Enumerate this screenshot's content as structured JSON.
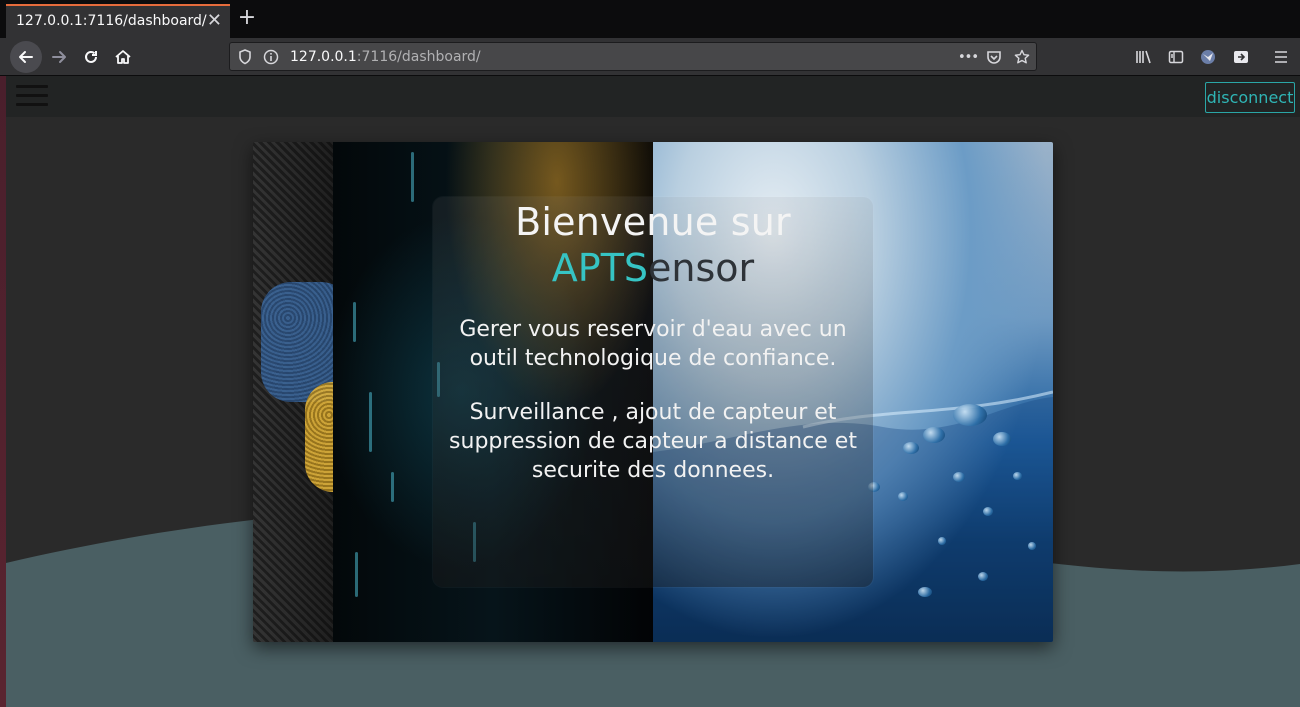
{
  "browser": {
    "tab_title": "127.0.0.1:7116/dashboard/",
    "tab_close": "✕",
    "new_tab": "+",
    "url_host": "127.0.0.1",
    "url_rest": ":7116/dashboard/",
    "page_actions": "•••",
    "accent_color": "#e66c3c"
  },
  "header": {
    "menu_icon": "hamburger-icon",
    "disconnect_label": "disconnect",
    "accent_color": "#2fb5b5"
  },
  "hero": {
    "title": "Bienvenue sur",
    "brand_part1": "APTS",
    "brand_part2": "ensor",
    "description_1": "Gerer vous reservoir d'eau avec un outil technologique de confiance.",
    "description_2": "Surveillance , ajout de capteur et suppression de capteur a distance et securite des donnees."
  }
}
